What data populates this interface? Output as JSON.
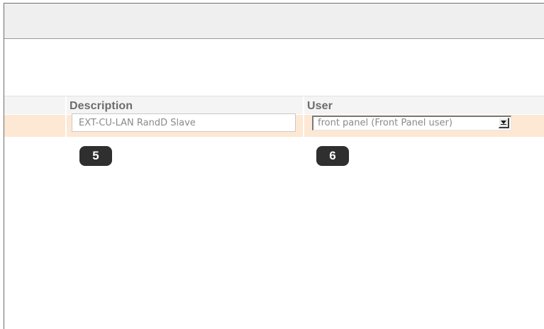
{
  "table": {
    "headers": {
      "description": "Description",
      "user": "User"
    },
    "row": {
      "description_value": "EXT-CU-LAN RandD Slave",
      "user_selected": "front panel (Front Panel user)"
    }
  },
  "callouts": {
    "description_marker": "5",
    "user_marker": "6"
  },
  "colors": {
    "row_highlight": "#fde8d4",
    "header_bg": "#f4f4f4",
    "toolbar_bg": "#efefef",
    "header_text": "#6c6c6c",
    "badge_bg": "#2f2f2f"
  },
  "icons": {
    "select_arrow": "chevron-down-icon"
  }
}
